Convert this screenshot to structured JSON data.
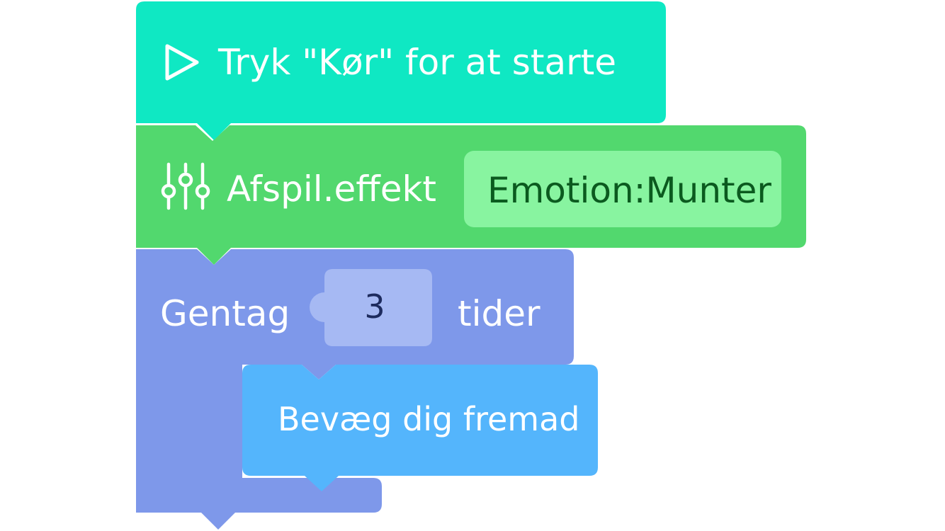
{
  "colors": {
    "start_block": "#0fe8c3",
    "effect_block": "#52d86e",
    "effect_value_field": "#88f4a0",
    "effect_value_text": "#0b5a1f",
    "repeat_block": "#7e98ea",
    "repeat_count_field": "#a6b9f3",
    "move_block": "#54b5fc",
    "text_light": "#ffffff"
  },
  "blocks": {
    "start": {
      "icon": "play-icon",
      "label": "Tryk \"Kør\" for at starte"
    },
    "effect": {
      "icon": "sliders-icon",
      "label": "Afspil.effekt",
      "value": "Emotion:Munter"
    },
    "repeat": {
      "label": "Gentag",
      "count": "3",
      "suffix": "tider",
      "body": {
        "move": {
          "label": "Bevæg dig fremad"
        }
      }
    }
  }
}
